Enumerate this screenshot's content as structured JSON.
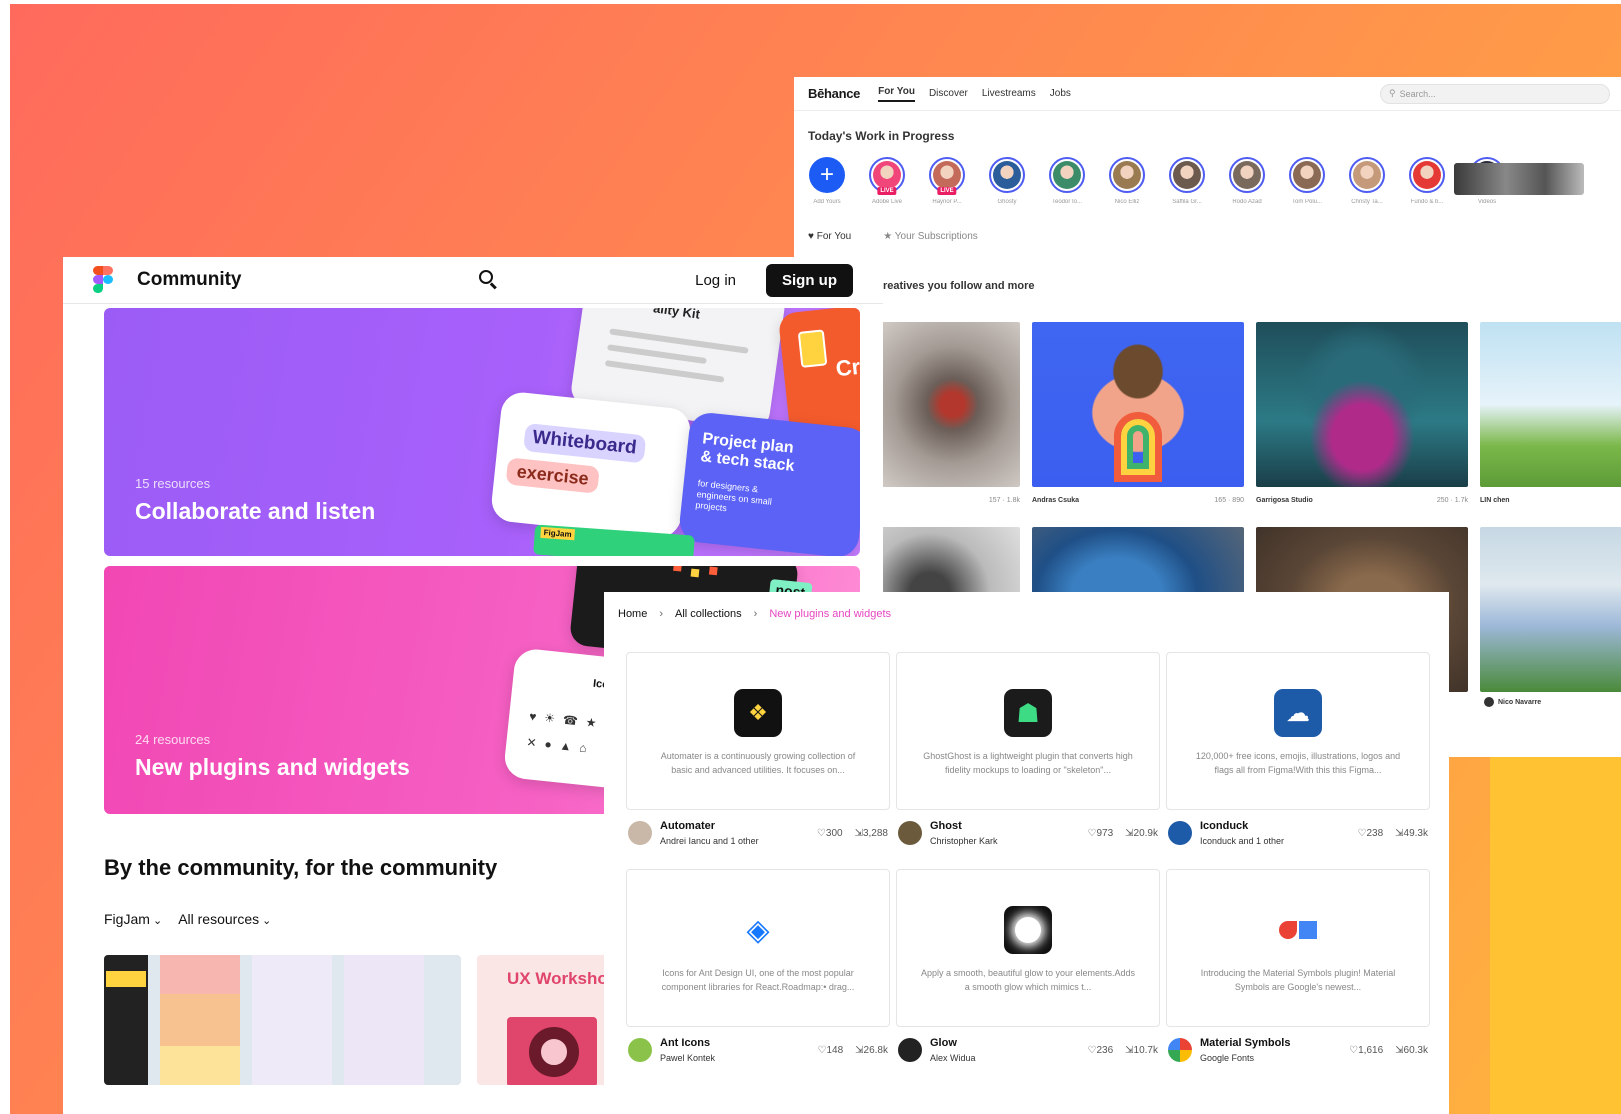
{
  "behance": {
    "logo": "Bēhance",
    "tabs": [
      "For You",
      "Discover",
      "Livestreams",
      "Jobs"
    ],
    "search_placeholder": "Search...",
    "wip_title": "Today's Work in Progress",
    "stories": [
      {
        "caption": "Add Yours",
        "color": "#1c5cf5",
        "live": false
      },
      {
        "caption": "Adobe Live",
        "color": "#f0467a",
        "live": true
      },
      {
        "caption": "Haynor P...",
        "color": "#c46a5a",
        "live": true
      },
      {
        "caption": "Ghosty",
        "color": "#2a5d9a",
        "live": false
      },
      {
        "caption": "Teodor Io...",
        "color": "#3c8c6a",
        "live": false
      },
      {
        "caption": "Nico Elliz",
        "color": "#9a7a50",
        "live": false
      },
      {
        "caption": "Saffila Gr...",
        "color": "#6d5a4f",
        "live": false
      },
      {
        "caption": "Rodo Azad",
        "color": "#7a6a5e",
        "live": false
      },
      {
        "caption": "Tom Polu...",
        "color": "#8a6a55",
        "live": false
      },
      {
        "caption": "Christy Ta...",
        "color": "#c49a7a",
        "live": false
      },
      {
        "caption": "Fundo & b...",
        "color": "#e53935",
        "live": false
      },
      {
        "caption": "Videos",
        "color": "#2a2a3a",
        "live": false
      }
    ],
    "filter_for_you": "For You",
    "filter_subscriptions": "Your Subscriptions",
    "subtitle": "m creatives you follow and more",
    "cards": [
      {
        "author": "",
        "stats": "157 · 1.8k"
      },
      {
        "author": "Andras Csuka",
        "stats": "165 · 890"
      },
      {
        "author": "Garrigosa Studio",
        "stats": "250 · 1.7k"
      },
      {
        "author": "LIN chen",
        "stats": ""
      }
    ],
    "bottom_author": "Nico Navarre"
  },
  "community": {
    "title": "Community",
    "login": "Log in",
    "signup": "Sign up",
    "banners": [
      {
        "count": "15 resources",
        "name": "Collaborate and listen"
      },
      {
        "count": "24 resources",
        "name": "New plugins and widgets"
      }
    ],
    "art": {
      "kit": "ality Kit",
      "whiteboard": "Whiteboard",
      "exercise": "exercise",
      "project": "Project plan & tech stack",
      "project_sub": "for designers & engineers on small projects",
      "figjam": "FigJam",
      "cro": "Cro",
      "host": "nost",
      "iconduck": "Iconduck"
    },
    "section_title": "By the community, for the community",
    "filters": [
      "FigJam",
      "All resources"
    ],
    "ux_workshop": "UX Workshop"
  },
  "plugins": {
    "breadcrumb": [
      "Home",
      "All collections",
      "New plugins and widgets"
    ],
    "items": [
      {
        "name": "Automater",
        "author": "Andrei Iancu and 1 other",
        "likes": "300",
        "uses": "3,288",
        "desc": "Automater is a continuously growing collection of basic and advanced utilities. It focuses on...",
        "icon_bg": "#111111",
        "avatar": "#c9b8a8"
      },
      {
        "name": "Ghost",
        "author": "Christopher Kark",
        "likes": "973",
        "uses": "20.9k",
        "desc": "GhostGhost is a lightweight plugin that converts high fidelity mockups to loading or \"skeleton\"...",
        "icon_bg": "#1b1b1b",
        "avatar": "#6b5a3c"
      },
      {
        "name": "Iconduck",
        "author": "Iconduck and 1 other",
        "likes": "238",
        "uses": "49.3k",
        "desc": "120,000+ free icons, emojis, illustrations, logos and flags all from Figma!With this this Figma...",
        "icon_bg": "#1d5aa8",
        "avatar": "#1d5aa8"
      },
      {
        "name": "Ant Icons",
        "author": "Pawel Kontek",
        "likes": "148",
        "uses": "26.8k",
        "desc": "Icons for Ant Design UI, one of the most popular component libraries for React.Roadmap:• drag...",
        "icon_bg": "#ffffff",
        "avatar": "#8bc34a"
      },
      {
        "name": "Glow",
        "author": "Alex Widua",
        "likes": "236",
        "uses": "10.7k",
        "desc": "Apply a smooth, beautiful glow to your elements.Adds a smooth glow which mimics t...",
        "icon_bg": "#111111",
        "avatar": "#222222"
      },
      {
        "name": "Material Symbols",
        "author": "Google Fonts",
        "likes": "1,616",
        "uses": "60.3k",
        "desc": "Introducing the Material Symbols plugin! Material Symbols are Google's newest...",
        "icon_bg": "#ffffff",
        "avatar": "#ffffff"
      }
    ]
  }
}
